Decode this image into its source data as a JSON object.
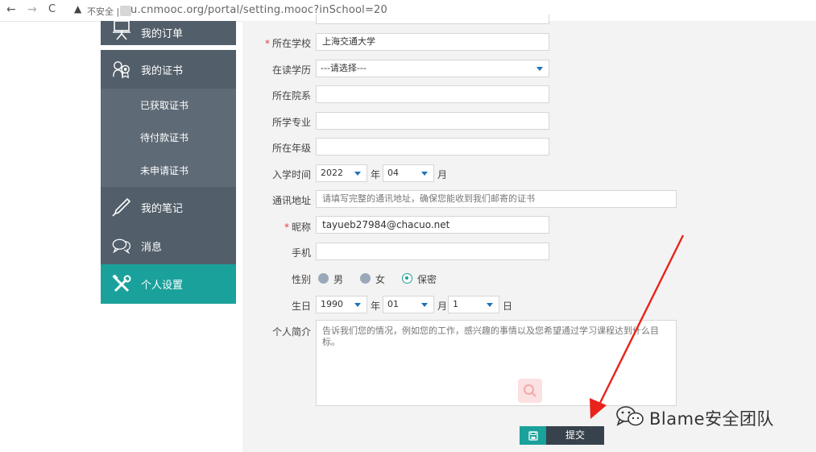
{
  "browser": {
    "back": "←",
    "forward": "→",
    "reload": "C",
    "warning": "▲",
    "insecure_label": "不安全 |",
    "url": "u.cnmooc.org/portal/setting.mooc?inSchool=20"
  },
  "sidebar": {
    "items": [
      {
        "label": "我的订单",
        "icon": "easel-icon"
      },
      {
        "label": "我的证书",
        "icon": "certificate-icon"
      },
      {
        "label": "已获取证书"
      },
      {
        "label": "待付款证书"
      },
      {
        "label": "未申请证书"
      },
      {
        "label": "我的笔记",
        "icon": "pen-icon"
      },
      {
        "label": "消息",
        "icon": "chat-icon"
      },
      {
        "label": "个人设置",
        "icon": "tools-icon"
      }
    ],
    "colors": {
      "menu": "#525e69",
      "submenu": "#5e6a76",
      "active": "#1ba19b"
    }
  },
  "form": {
    "school": {
      "label": "所在学校",
      "value": "上海交通大学",
      "required": "*"
    },
    "education": {
      "label": "在读学历",
      "value": "---请选择---"
    },
    "department": {
      "label": "所在院系",
      "value": ""
    },
    "major": {
      "label": "所学专业",
      "value": ""
    },
    "grade": {
      "label": "所在年级",
      "value": ""
    },
    "enroll": {
      "label": "入学时间",
      "year": "2022",
      "year_unit": "年",
      "month": "04",
      "month_unit": "月"
    },
    "address": {
      "label": "通讯地址",
      "placeholder": "请填写完整的通讯地址，确保您能收到我们邮寄的证书"
    },
    "nickname": {
      "label": "昵称",
      "value": "tayueb27984@chacuo.net",
      "required": "*"
    },
    "phone": {
      "label": "手机",
      "value": ""
    },
    "gender": {
      "label": "性别",
      "options": [
        "男",
        "女",
        "保密"
      ],
      "selected": "保密"
    },
    "birthday": {
      "label": "生日",
      "year": "1990",
      "year_unit": "年",
      "month": "01",
      "month_unit": "月",
      "day": "1",
      "day_unit": "日"
    },
    "bio": {
      "label": "个人简介",
      "placeholder": "告诉我们您的情况，例如您的工作，感兴趣的事情以及您希望通过学习课程达到什么目标。"
    }
  },
  "submit": {
    "label": "提交"
  },
  "watermark": {
    "text": "Blame安全团队",
    "icon": "wechat-icon"
  },
  "colors": {
    "accent": "#1ba19b",
    "arrow": "#e8231b",
    "caret": "#1c72b8"
  }
}
